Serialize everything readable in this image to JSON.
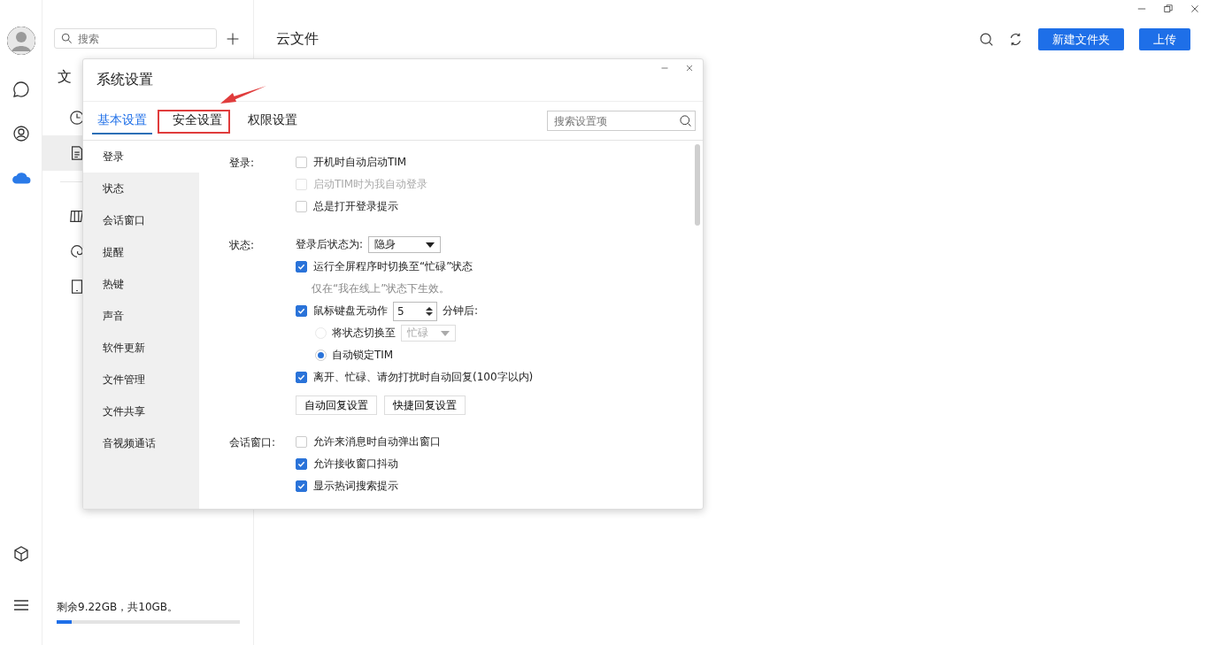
{
  "rail": [
    {
      "kind": "chat",
      "selected": false
    },
    {
      "kind": "contacts",
      "selected": false
    },
    {
      "kind": "cloud",
      "selected": true
    }
  ],
  "sidebar": {
    "search": {
      "placeholder": "搜索"
    },
    "title": "文",
    "items": [
      {
        "kind": "recent",
        "selected": false
      },
      {
        "kind": "document",
        "selected": true
      },
      {
        "kind": "shared",
        "selected": false
      },
      {
        "kind": "swirl",
        "selected": false
      },
      {
        "kind": "tablet",
        "selected": false
      }
    ],
    "storage": {
      "text": "剩余9.22GB，共10GB。",
      "level": 0.08
    }
  },
  "main": {
    "title": "云文件",
    "buttons": [
      "新建文件夹",
      "上传"
    ]
  },
  "dialog": {
    "title": "系统设置",
    "tabs": [
      {
        "label": "基本设置",
        "selected": true
      },
      {
        "label": "安全设置",
        "selected": false
      },
      {
        "label": "权限设置",
        "selected": false
      }
    ],
    "search": {
      "placeholder": "搜索设置项"
    },
    "nav": [
      {
        "label": "登录",
        "selected": true
      },
      {
        "label": "状态",
        "selected": false
      },
      {
        "label": "会话窗口",
        "selected": false
      },
      {
        "label": "提醒",
        "selected": false
      },
      {
        "label": "热键",
        "selected": false
      },
      {
        "label": "声音",
        "selected": false
      },
      {
        "label": "软件更新",
        "selected": false
      },
      {
        "label": "文件管理",
        "selected": false
      },
      {
        "label": "文件共享",
        "selected": false
      },
      {
        "label": "音视频通话",
        "selected": false
      }
    ],
    "sections": [
      {
        "label": "登录:",
        "rows": [
          {
            "kind": "checkbox",
            "label": "开机时自动启动TIM",
            "checked": false,
            "disabled": false
          },
          {
            "kind": "checkbox",
            "label": "启动TIM时为我自动登录",
            "checked": false,
            "disabled": true
          },
          {
            "kind": "checkbox",
            "label": "总是打开登录提示",
            "checked": false,
            "disabled": false
          }
        ]
      },
      {
        "label": "状态:",
        "rows": [
          {
            "kind": "select",
            "label": "登录后状态为:",
            "value": "隐身"
          },
          {
            "kind": "checkbox",
            "label": "运行全屏程序时切换至“忙碌”状态",
            "checked": true,
            "disabled": false
          },
          {
            "kind": "note",
            "label": "仅在“我在线上”状态下生效。"
          },
          {
            "kind": "spin",
            "label": "鼠标键盘无动作",
            "checked": true,
            "value": "5",
            "suffix": "分钟后:"
          },
          {
            "kind": "radio",
            "label": "将状态切换至",
            "selected": false,
            "select": {
              "value": "忙碌",
              "disabled": true
            }
          },
          {
            "kind": "radio",
            "label": "自动锁定TIM",
            "selected": true
          },
          {
            "kind": "checkbox",
            "label": "离开、忙碌、请勿打扰时自动回复(100字以内)",
            "checked": true,
            "disabled": false
          },
          {
            "kind": "buttons",
            "buttons": [
              "自动回复设置",
              "快捷回复设置"
            ]
          }
        ]
      },
      {
        "label": "会话窗口:",
        "rows": [
          {
            "kind": "checkbox",
            "label": "允许来消息时自动弹出窗口",
            "checked": false,
            "disabled": false
          },
          {
            "kind": "checkbox",
            "label": "允许接收窗口抖动",
            "checked": true,
            "disabled": false
          },
          {
            "kind": "checkbox",
            "label": "显示热词搜索提示",
            "checked": true,
            "disabled": false
          }
        ]
      }
    ]
  }
}
